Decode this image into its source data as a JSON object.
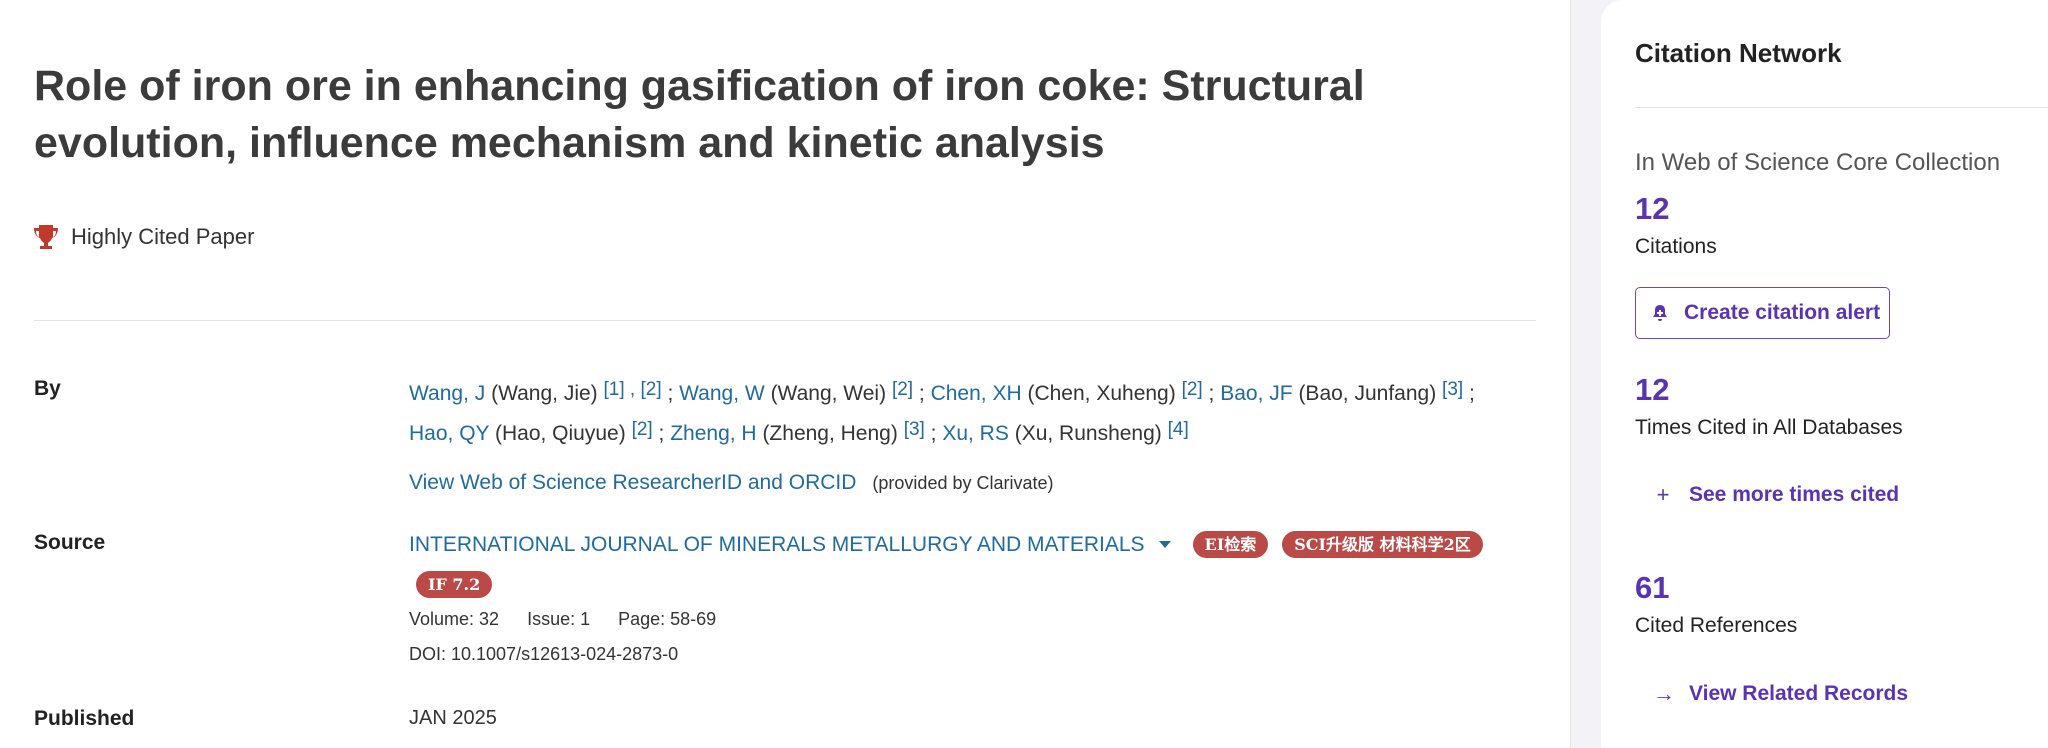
{
  "article": {
    "title": "Role of iron ore in enhancing gasification of iron coke: Structural evolution, influence mechanism and kinetic analysis",
    "badge": "Highly Cited Paper"
  },
  "labels": {
    "by": "By",
    "source": "Source",
    "published": "Published"
  },
  "authors": [
    {
      "short": "Wang, J",
      "full": "(Wang, Jie)",
      "aff": "[1] , [2]",
      "sep": " ; "
    },
    {
      "short": "Wang, W",
      "full": "(Wang, Wei)",
      "aff": "[2]",
      "sep": " ; "
    },
    {
      "short": "Chen, XH",
      "full": "(Chen, Xuheng)",
      "aff": "[2]",
      "sep": " ; "
    },
    {
      "short": "Bao, JF",
      "full": "(Bao, Junfang)",
      "aff": "[3]",
      "sep": " ; "
    },
    {
      "short": "Hao, QY",
      "full": "(Hao, Qiuyue)",
      "aff": "[2]",
      "sep": " ; "
    },
    {
      "short": "Zheng, H",
      "full": "(Zheng, Heng)",
      "aff": "[3]",
      "sep": " ; "
    },
    {
      "short": "Xu, RS",
      "full": "(Xu, Runsheng)",
      "aff": "[4]",
      "sep": ""
    }
  ],
  "researcher": {
    "link": "View Web of Science ResearcherID and ORCID",
    "provided": "(provided by Clarivate)"
  },
  "source": {
    "journal": "INTERNATIONAL JOURNAL OF MINERALS METALLURGY AND MATERIALS",
    "tags": [
      "EI检索",
      "SCI升级版 材料科学2区"
    ],
    "if_tag": "IF 7.2",
    "volume": "Volume: 32",
    "issue": "Issue: 1",
    "page": "Page: 58-69",
    "doi": "DOI: 10.1007/s12613-024-2873-0",
    "published": "JAN 2025"
  },
  "sidebar": {
    "title": "Citation Network",
    "collection": "In Web of Science Core Collection",
    "citations_count": "12",
    "citations_label": "Citations",
    "alert_button": "Create citation alert",
    "times_cited_count": "12",
    "times_cited_label": "Times Cited in All Databases",
    "see_more": "See more times cited",
    "refs_count": "61",
    "refs_label": "Cited References",
    "related": "View Related Records"
  },
  "colors": {
    "link": "#1f6b9b",
    "accent": "#5a33b5",
    "tag": "#b94a48",
    "trophy": "#c0392b"
  },
  "icons": [
    "trophy-icon",
    "caret-down-icon",
    "bell-icon",
    "plus-icon",
    "arrow-right-icon"
  ]
}
